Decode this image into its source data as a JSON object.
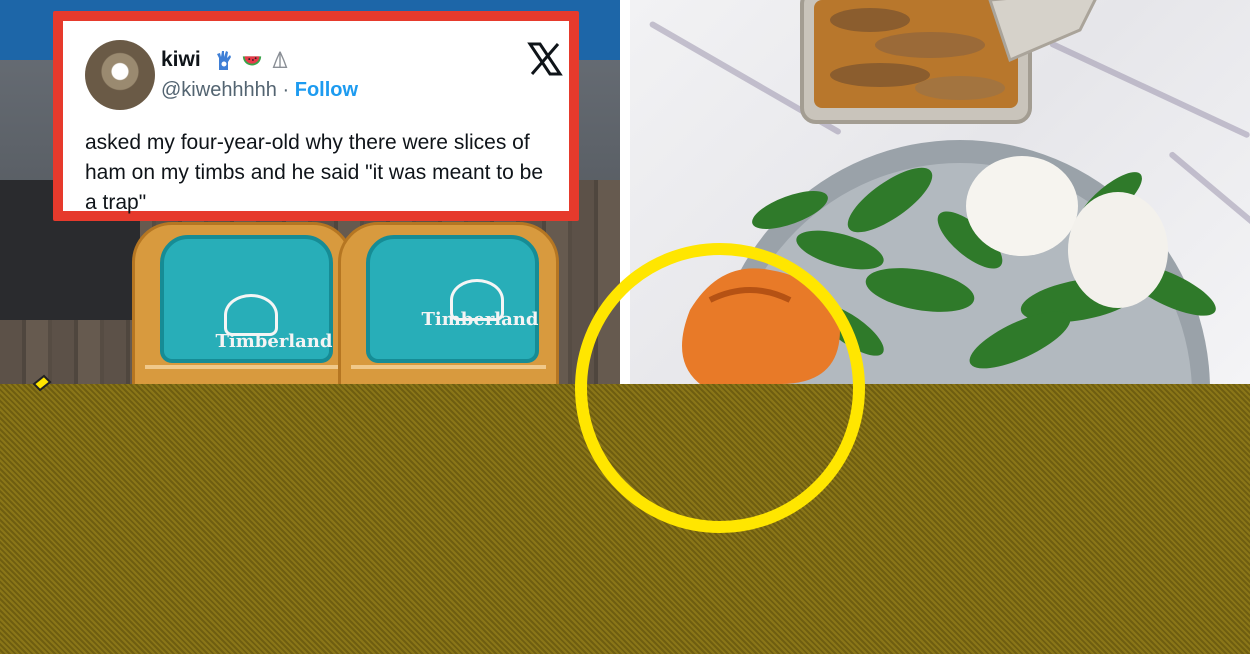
{
  "tweet": {
    "display_name": "kiwi",
    "handle": "@kiwehhhhh",
    "separator": "·",
    "follow_label": "Follow",
    "text": "asked my four-year-old why there were slices of ham on my timbs and he said \"it was meant to be a trap\"",
    "emojis": [
      "hamsa-emoji",
      "watermelon-emoji",
      "praying-hands-emoji"
    ],
    "platform_icon": "x-logo-icon"
  },
  "left_photo": {
    "boot_brand_left": "Timberland",
    "boot_brand_right": "Timberland"
  },
  "colors": {
    "tweet_border": "#e63a2c",
    "follow_link": "#1d9bf0",
    "highlight_ring": "#ffe600",
    "overlay_band": "#7d6b14",
    "boot_teal": "#28aeb8"
  }
}
